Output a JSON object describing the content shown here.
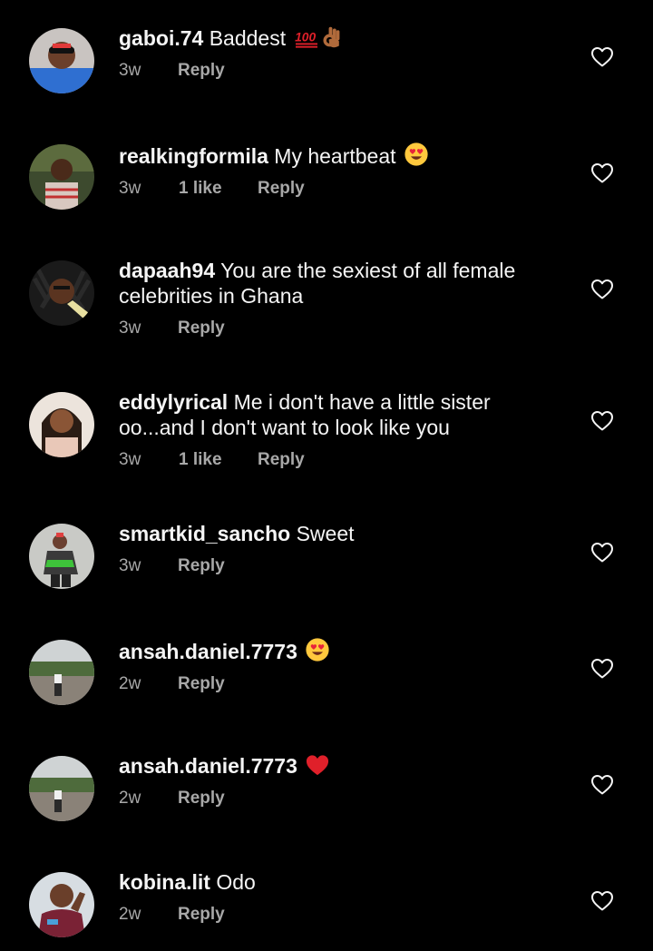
{
  "colors": {
    "background": "#000000",
    "text": "#f5f5f5",
    "meta": "#a8a8a8",
    "heart_outline": "#f5f5f5",
    "red_heart": "#e0202a"
  },
  "comments": [
    {
      "username": "gaboi.74",
      "text": " Baddest ",
      "emoji": [
        "hundred-points-emoji",
        "ok-hand-emoji"
      ],
      "time": "3w",
      "likes": "",
      "reply": "Reply"
    },
    {
      "username": "realkingformila",
      "text": " My heartbeat ",
      "emoji": [
        "heart-eyes-emoji"
      ],
      "time": "3w",
      "likes": "1 like",
      "reply": "Reply"
    },
    {
      "username": "dapaah94",
      "text": " You are the sexiest of all female celebrities in Ghana",
      "emoji": [],
      "time": "3w",
      "likes": "",
      "reply": "Reply"
    },
    {
      "username": "eddylyrical",
      "text": " Me i don't have a little sister oo...and I don't want to look like you",
      "emoji": [],
      "time": "3w",
      "likes": "1 like",
      "reply": "Reply"
    },
    {
      "username": "smartkid_sancho",
      "text": " Sweet",
      "emoji": [],
      "time": "3w",
      "likes": "",
      "reply": "Reply"
    },
    {
      "username": "ansah.daniel.7773",
      "text": " ",
      "emoji": [
        "heart-eyes-emoji"
      ],
      "time": "2w",
      "likes": "",
      "reply": "Reply"
    },
    {
      "username": "ansah.daniel.7773",
      "text": " ",
      "emoji": [
        "red-heart-emoji"
      ],
      "time": "2w",
      "likes": "",
      "reply": "Reply"
    },
    {
      "username": "kobina.lit",
      "text": " Odo",
      "emoji": [],
      "time": "2w",
      "likes": "",
      "reply": "Reply"
    }
  ],
  "icons": {
    "like": "heart-outline-icon",
    "avatar": "profile-photo"
  }
}
